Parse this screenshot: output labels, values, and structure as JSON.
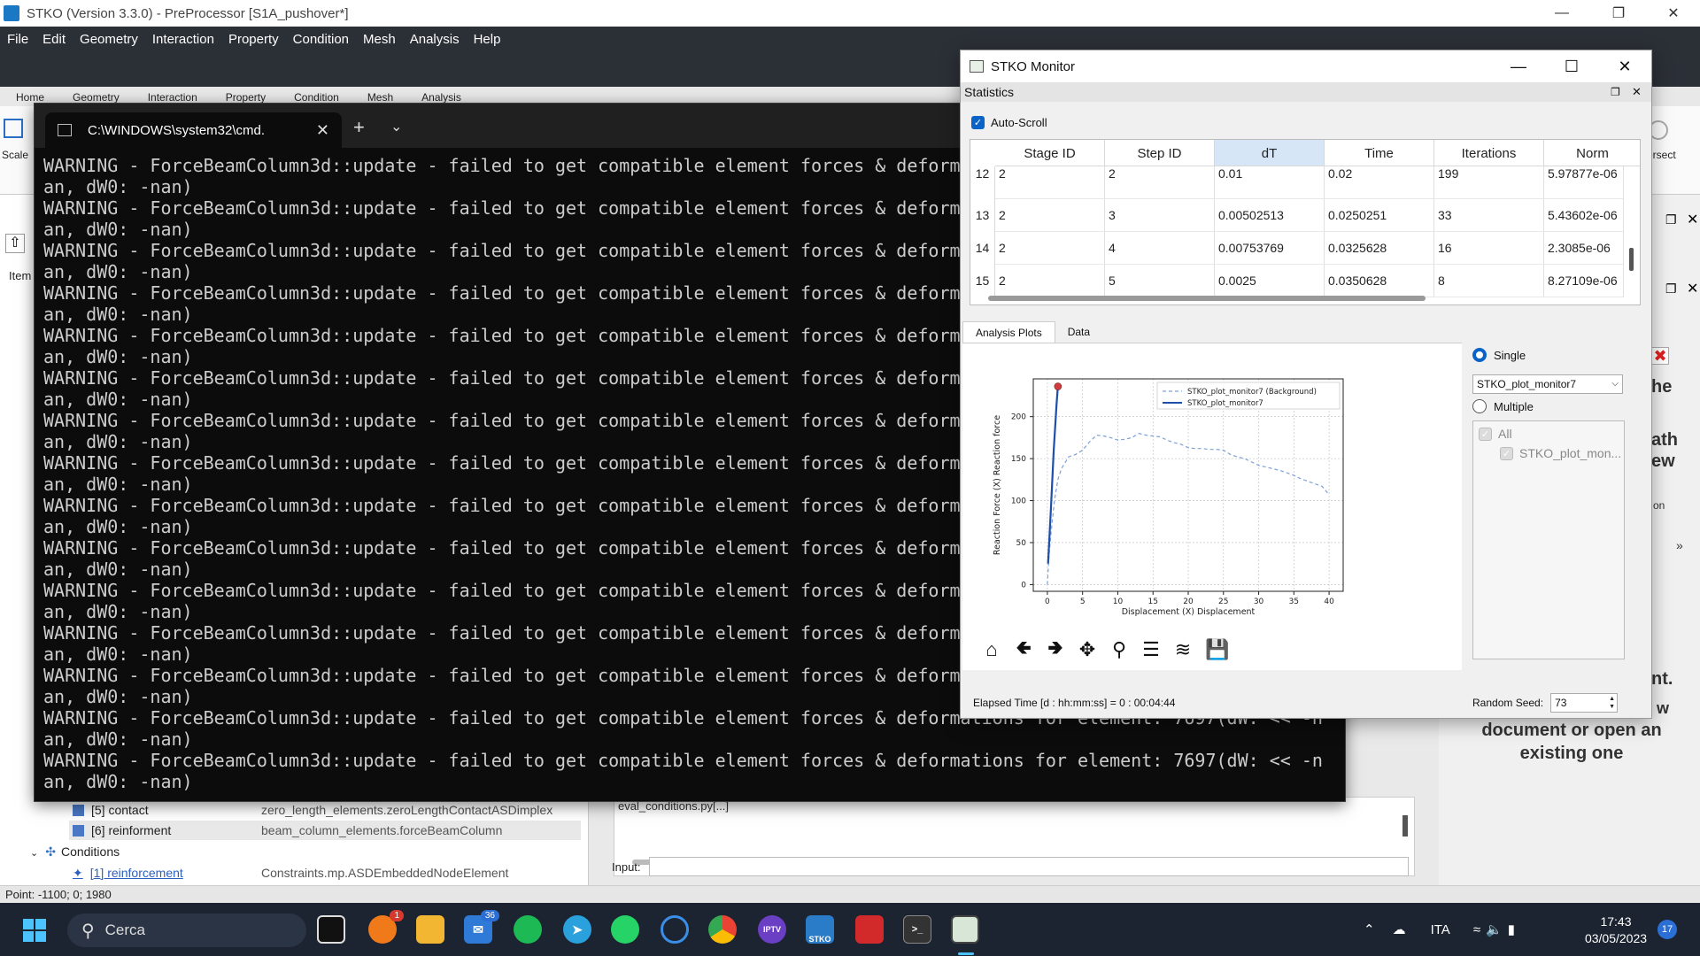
{
  "stko": {
    "title": "STKO (Version 3.3.0) - PreProcessor [S1A_pushover*]",
    "menu": [
      "File",
      "Edit",
      "Geometry",
      "Interaction",
      "Property",
      "Condition",
      "Mesh",
      "Analysis",
      "Help"
    ],
    "ribbon_tabs": [
      "Home",
      "Geometry",
      "Interaction",
      "Property",
      "Condition",
      "Mesh",
      "Analysis"
    ],
    "ribbon_left_label": "Scale",
    "ribbon_right_label": "ersect",
    "left_panel_label": "Item",
    "tree": {
      "row1_label": "[5] contact",
      "row1_value": "zero_length_elements.zeroLengthContactASDimplex",
      "row2_label": "[6] reinforment",
      "row2_value": "beam_column_elements.forceBeamColumn",
      "row3_label": "Conditions",
      "row4_label": "[1] reinforcement",
      "row4_value": "Constraints.mp.ASDEmbeddedNodeElement"
    },
    "center_snippet": "eval_conditions.py[...]",
    "input_label": "Input:",
    "right_panel": {
      "frag1": "he",
      "frag2": "ath",
      "frag3": "ew",
      "frag4": "on",
      "frag5": "nt.",
      "frag6": "w",
      "message_line1": "document or open an",
      "message_line2": "existing one"
    },
    "status": "Point: -1100; 0; 1980"
  },
  "cmd": {
    "tab_title": "C:\\WINDOWS\\system32\\cmd.",
    "lines": [
      "WARNING - ForceBeamColumn3d::update - failed to get compatible element forces & deformations for element: 7697(dW: << -n",
      "an, dW0: -nan)",
      "WARNING - ForceBeamColumn3d::update - failed to get compatible element forces & deformations for element: 7697(dW: << -n",
      "an, dW0: -nan)",
      "WARNING - ForceBeamColumn3d::update - failed to get compatible element forces & deformations for element: 7697(dW: << -n",
      "an, dW0: -nan)",
      "WARNING - ForceBeamColumn3d::update - failed to get compatible element forces & deformations for element: 7697(dW: << -n",
      "an, dW0: -nan)",
      "WARNING - ForceBeamColumn3d::update - failed to get compatible element forces & deformations for element: 7697(dW: << -n",
      "an, dW0: -nan)",
      "WARNING - ForceBeamColumn3d::update - failed to get compatible element forces & deformations for element: 7697(dW: << -n",
      "an, dW0: -nan)",
      "WARNING - ForceBeamColumn3d::update - failed to get compatible element forces & deformations for element: 7697(dW: << -n",
      "an, dW0: -nan)",
      "WARNING - ForceBeamColumn3d::update - failed to get compatible element forces & deformations for element: 7697(dW: << -n",
      "an, dW0: -nan)",
      "WARNING - ForceBeamColumn3d::update - failed to get compatible element forces & deformations for element: 7697(dW: << -n",
      "an, dW0: -nan)",
      "WARNING - ForceBeamColumn3d::update - failed to get compatible element forces & deformations for element: 7697(dW: << -n",
      "an, dW0: -nan)",
      "WARNING - ForceBeamColumn3d::update - failed to get compatible element forces & deformations for element: 7697(dW: << -n",
      "an, dW0: -nan)",
      "WARNING - ForceBeamColumn3d::update - failed to get compatible element forces & deformations for element: 7697(dW: << -n",
      "an, dW0: -nan)",
      "WARNING - ForceBeamColumn3d::update - failed to get compatible element forces & deformations for element: 7697(dW: << -n",
      "an, dW0: -nan)",
      "WARNING - ForceBeamColumn3d::update - failed to get compatible element forces & deformations for element: 7697(dW: << -n",
      "an, dW0: -nan)",
      "WARNING - ForceBeamColumn3d::update - failed to get compatible element forces & deformations for element: 7697(dW: << -n",
      "an, dW0: -nan)"
    ]
  },
  "monitor": {
    "title": "STKO Monitor",
    "stats_label": "Statistics",
    "autoscroll_label": "Auto-Scroll",
    "columns": [
      "Stage ID",
      "Step ID",
      "dT",
      "Time",
      "Iterations",
      "Norm"
    ],
    "rows": [
      {
        "idx": "12",
        "cells": [
          "2",
          "2",
          "0.01",
          "0.02",
          "199",
          "5.97877e-06"
        ]
      },
      {
        "idx": "13",
        "cells": [
          "2",
          "3",
          "0.00502513",
          "0.0250251",
          "33",
          "5.43602e-06"
        ]
      },
      {
        "idx": "14",
        "cells": [
          "2",
          "4",
          "0.00753769",
          "0.0325628",
          "16",
          "2.3085e-06"
        ]
      },
      {
        "idx": "15",
        "cells": [
          "2",
          "5",
          "0.0025",
          "0.0350628",
          "8",
          "8.27109e-06"
        ]
      }
    ],
    "tabs": [
      "Analysis Plots",
      "Data"
    ],
    "single_label": "Single",
    "plot_select_value": "STKO_plot_monitor7",
    "multiple_label": "Multiple",
    "all_label": "All",
    "plot_list_item": "STKO_plot_mon...",
    "seed_label": "Random Seed:",
    "seed_value": "73",
    "elapsed": "Elapsed Time [d : hh:mm:ss] = 0 : 00:04:44"
  },
  "chart_data": {
    "type": "line",
    "title": "",
    "xlabel": "Displacement (X) Displacement",
    "ylabel": "Reaction Force (X) Reaction force",
    "xlim": [
      -2,
      42
    ],
    "ylim": [
      -8,
      245
    ],
    "xticks": [
      0,
      5,
      10,
      15,
      20,
      25,
      30,
      35,
      40
    ],
    "yticks": [
      0,
      50,
      100,
      150,
      200
    ],
    "grid": true,
    "legend_position": "top-right",
    "series": [
      {
        "name": "STKO_plot_monitor7 (Background)",
        "style": "dashed",
        "color": "#7da0d8",
        "x": [
          0,
          0.2,
          0.5,
          1,
          1.5,
          2,
          3,
          4,
          5,
          6,
          7,
          8,
          9,
          10,
          11,
          12,
          13,
          14,
          15,
          16,
          17,
          18,
          19,
          20,
          21,
          22,
          23,
          24,
          25,
          26,
          27,
          28,
          29,
          30,
          31,
          32,
          33,
          34,
          35,
          36,
          37,
          38,
          39,
          40
        ],
        "y": [
          0,
          30,
          60,
          100,
          125,
          138,
          152,
          155,
          160,
          170,
          178,
          177,
          175,
          172,
          173,
          175,
          180,
          178,
          177,
          176,
          172,
          169,
          167,
          163,
          162,
          162,
          161,
          161,
          160,
          155,
          152,
          150,
          146,
          142,
          140,
          138,
          136,
          133,
          130,
          126,
          123,
          120,
          117,
          107
        ]
      },
      {
        "name": "STKO_plot_monitor7",
        "style": "solid",
        "color": "#1f4fa8",
        "x": [
          0.1,
          0.5,
          0.9,
          1.3,
          1.5
        ],
        "y": [
          25,
          90,
          160,
          215,
          236
        ]
      }
    ],
    "marker": {
      "x": 1.5,
      "y": 236,
      "color": "#d23c3c"
    }
  },
  "taskbar": {
    "search_label": "Cerca",
    "badge_firefox": "1",
    "badge_mail": "36",
    "iptv_label": "IPTV",
    "stko_label": "STKO",
    "lang": "ITA",
    "time": "17:43",
    "date": "03/05/2023",
    "notifications": "17"
  },
  "colors": {
    "accent": "#0a64c8",
    "terminal_bg": "#0c0c0c",
    "taskbar_bg": "#1c2431"
  }
}
